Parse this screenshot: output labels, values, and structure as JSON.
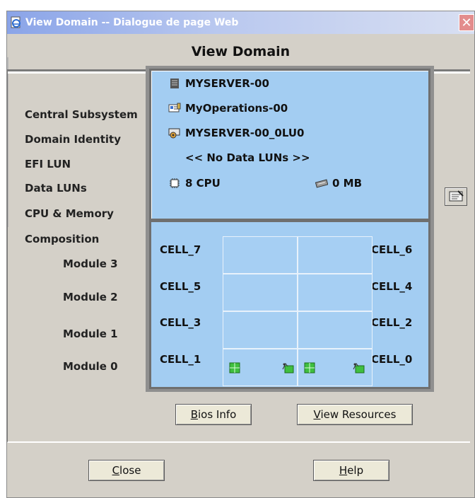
{
  "window": {
    "title": "View Domain -- Dialogue de page Web",
    "close_glyph": "✕",
    "heading": "View Domain"
  },
  "labels": {
    "central_subsystem": "Central Subsystem",
    "domain_identity": "Domain Identity",
    "efi_lun": "EFI LUN",
    "data_luns": "Data LUNs",
    "cpu_memory": "CPU & Memory",
    "composition": "Composition",
    "modules": [
      "Module 3",
      "Module 2",
      "Module 1",
      "Module 0"
    ]
  },
  "values": {
    "central_subsystem": "MYSERVER-00",
    "domain_identity": "MyOperations-00",
    "efi_lun": "MYSERVER-00_0LU0",
    "data_luns": "<< No Data LUNs >>",
    "cpu": "8 CPU",
    "memory": "0 MB"
  },
  "cells": {
    "left": [
      "CELL_7",
      "CELL_5",
      "CELL_3",
      "CELL_1"
    ],
    "right": [
      "CELL_6",
      "CELL_4",
      "CELL_2",
      "CELL_0"
    ]
  },
  "buttons": {
    "bios_info": {
      "mnemonic": "B",
      "rest": "ios Info"
    },
    "view_resources": {
      "mnemonic": "V",
      "rest": "iew Resources"
    },
    "close": {
      "mnemonic": "C",
      "rest": "lose"
    },
    "help": {
      "mnemonic": "H",
      "rest": "elp"
    }
  },
  "icons": {
    "title": "ie-page-icon",
    "central_subsystem": "server-icon",
    "domain_identity": "domain-card-icon",
    "efi_lun": "disk-icon",
    "cpu": "cpu-chip-icon",
    "memory": "memory-module-icon",
    "side_button": "edit-icon",
    "cell_chip": "green-chip-icon",
    "cell_io": "green-io-icon"
  },
  "colors": {
    "panel_blue": "#a3cdf2",
    "dialog_gray": "#d4d0c8",
    "title_gradient_start": "#8aa4e8",
    "close_red": "#e38d8d"
  }
}
